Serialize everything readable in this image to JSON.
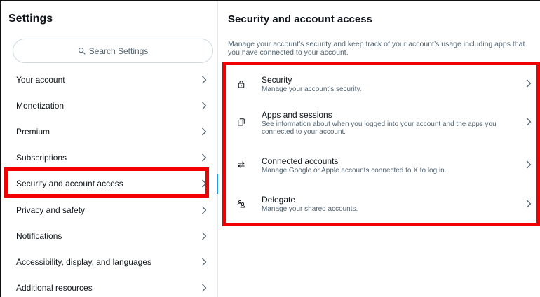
{
  "left": {
    "title": "Settings",
    "search_placeholder": "Search Settings",
    "items": [
      {
        "label": "Your account"
      },
      {
        "label": "Monetization"
      },
      {
        "label": "Premium"
      },
      {
        "label": "Subscriptions"
      },
      {
        "label": "Security and account access",
        "active": true
      },
      {
        "label": "Privacy and safety"
      },
      {
        "label": "Notifications"
      },
      {
        "label": "Accessibility, display, and languages"
      },
      {
        "label": "Additional resources"
      }
    ]
  },
  "right": {
    "title": "Security and account access",
    "description": "Manage your account’s security and keep track of your account’s usage including apps that you have connected to your account.",
    "items": [
      {
        "title": "Security",
        "desc": "Manage your account’s security.",
        "icon": "lock-icon"
      },
      {
        "title": "Apps and sessions",
        "desc": "See information about when you logged into your account and the apps you connected to your account.",
        "icon": "apps-icon"
      },
      {
        "title": "Connected accounts",
        "desc": "Manage Google or Apple accounts connected to X to log in.",
        "icon": "arrows-swap-icon"
      },
      {
        "title": "Delegate",
        "desc": "Manage your shared accounts.",
        "icon": "people-icon"
      }
    ]
  },
  "colors": {
    "accent": "#1d9bf0",
    "highlight": "#f20000",
    "text": "#0f1419",
    "muted": "#536471"
  }
}
